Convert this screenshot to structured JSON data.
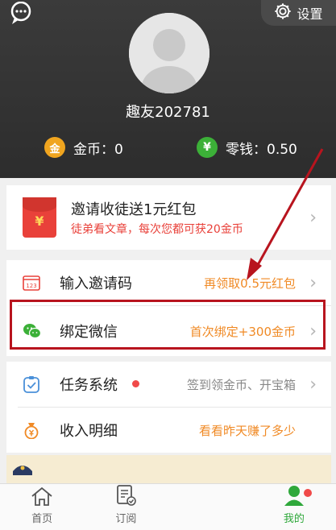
{
  "header": {
    "settings_label": "设置",
    "username": "趣友202781",
    "coins_label": "金币：0",
    "coin_icon_text": "金",
    "change_label": "零钱：0.50",
    "change_icon_text": "¥"
  },
  "invite": {
    "envelope_text": "¥",
    "title": "邀请收徒送1元红包",
    "subtitle": "徒弟看文章，每次您都可获20金币"
  },
  "menu": {
    "invite_code": {
      "label": "输入邀请码",
      "icon_text": "123",
      "hint": "再领取0.5元红包"
    },
    "bind_wechat": {
      "label": "绑定微信",
      "hint": "首次绑定+300金币"
    },
    "task_system": {
      "label": "任务系统",
      "hint": "签到领金币、开宝箱"
    },
    "income": {
      "label": "收入明细",
      "hint": "看看昨天赚了多少"
    }
  },
  "chevron": "›",
  "tabs": [
    {
      "label": "首页"
    },
    {
      "label": "订阅"
    },
    {
      "label": ""
    },
    {
      "label": "我的"
    }
  ],
  "colors": {
    "accent_orange": "#f08a25",
    "accent_green": "#2fa83b",
    "accent_red": "#e9413a",
    "highlight_box": "#b8141e"
  }
}
